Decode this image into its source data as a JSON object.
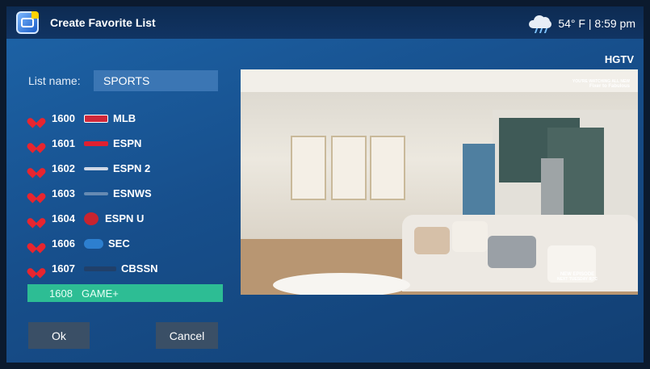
{
  "header": {
    "title": "Create Favorite List",
    "app_icon": "app-logo-icon",
    "weather_icon": "cloud-rain-icon",
    "temperature": "54° F",
    "time": "8:59 pm"
  },
  "preview": {
    "channel": "HGTV",
    "overlay_top_line1": "YOU'RE WATCHING ALL NEW",
    "overlay_top_line2": "Fixer to Fabulous",
    "overlay_bottom_line1": "NEW EPISODE",
    "overlay_bottom_line2": "NEXT TUESDAY 8|7C"
  },
  "form": {
    "label": "List name:",
    "value": "SPORTS"
  },
  "channels": [
    {
      "number": "1600",
      "name": "MLB",
      "favorite": true,
      "logo_color": "#d0283a"
    },
    {
      "number": "1601",
      "name": "ESPN",
      "favorite": true,
      "logo_color": "#e02030"
    },
    {
      "number": "1602",
      "name": "ESPN 2",
      "favorite": true,
      "logo_color": "#cfd8e6"
    },
    {
      "number": "1603",
      "name": "ESNWS",
      "favorite": true,
      "logo_color": "#9bb1c9"
    },
    {
      "number": "1604",
      "name": "ESPN U",
      "favorite": true,
      "logo_color": "#c8242f"
    },
    {
      "number": "1606",
      "name": "SEC",
      "favorite": true,
      "logo_color": "#2d7fcf"
    },
    {
      "number": "1607",
      "name": "CBSSN",
      "favorite": true,
      "logo_color": "#20406a"
    },
    {
      "number": "1608",
      "name": "GAME+",
      "favorite": false,
      "selected": true
    }
  ],
  "buttons": {
    "ok": "Ok",
    "cancel": "Cancel"
  },
  "colors": {
    "accent": "#2dbd94",
    "heart": "#e8252f"
  }
}
